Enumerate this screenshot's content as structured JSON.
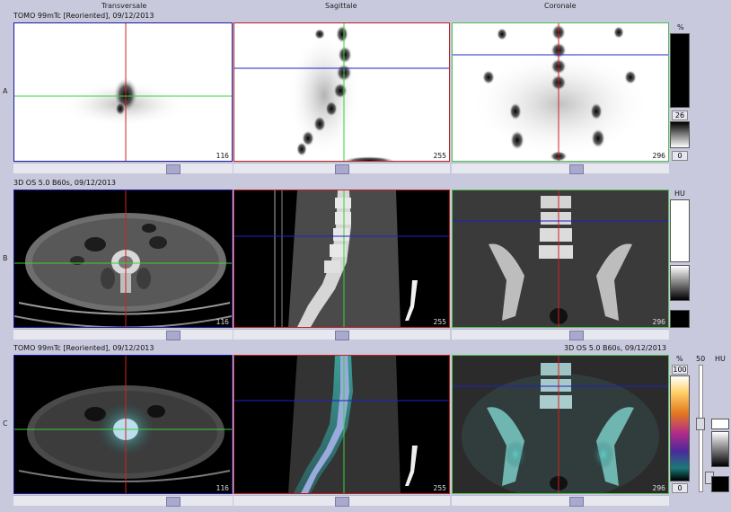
{
  "columns": [
    "Transversale",
    "Sagittale",
    "Coronale"
  ],
  "rows": [
    "A",
    "B",
    "C"
  ],
  "row_labels": {
    "a": "TOMO 99mTc [Reoriented], 09/12/2013",
    "b": "3D OS 5.0 B60s, 09/12/2013",
    "c_left": "TOMO 99mTc [Reoriented], 09/12/2013",
    "c_right": "3D OS 5.0 B60s, 09/12/2013"
  },
  "slice_numbers": {
    "transversale": "116",
    "sagittale": "255",
    "coronale": "296"
  },
  "colorbars": {
    "a": {
      "unit": "%",
      "upper": "26",
      "lower": "0"
    },
    "b": {
      "unit": "HU"
    },
    "c": {
      "unit_left": "%",
      "upper": "100",
      "lower": "0",
      "slider_value": "50",
      "unit_right": "HU"
    }
  },
  "colors": {
    "crosshair_red": "#d42020",
    "crosshair_green": "#3ad13a",
    "crosshair_blue": "#2020c8",
    "frame_transversale": "#1a1aa0",
    "frame_sagittale": "#c02020",
    "frame_coronale": "#50c050"
  }
}
